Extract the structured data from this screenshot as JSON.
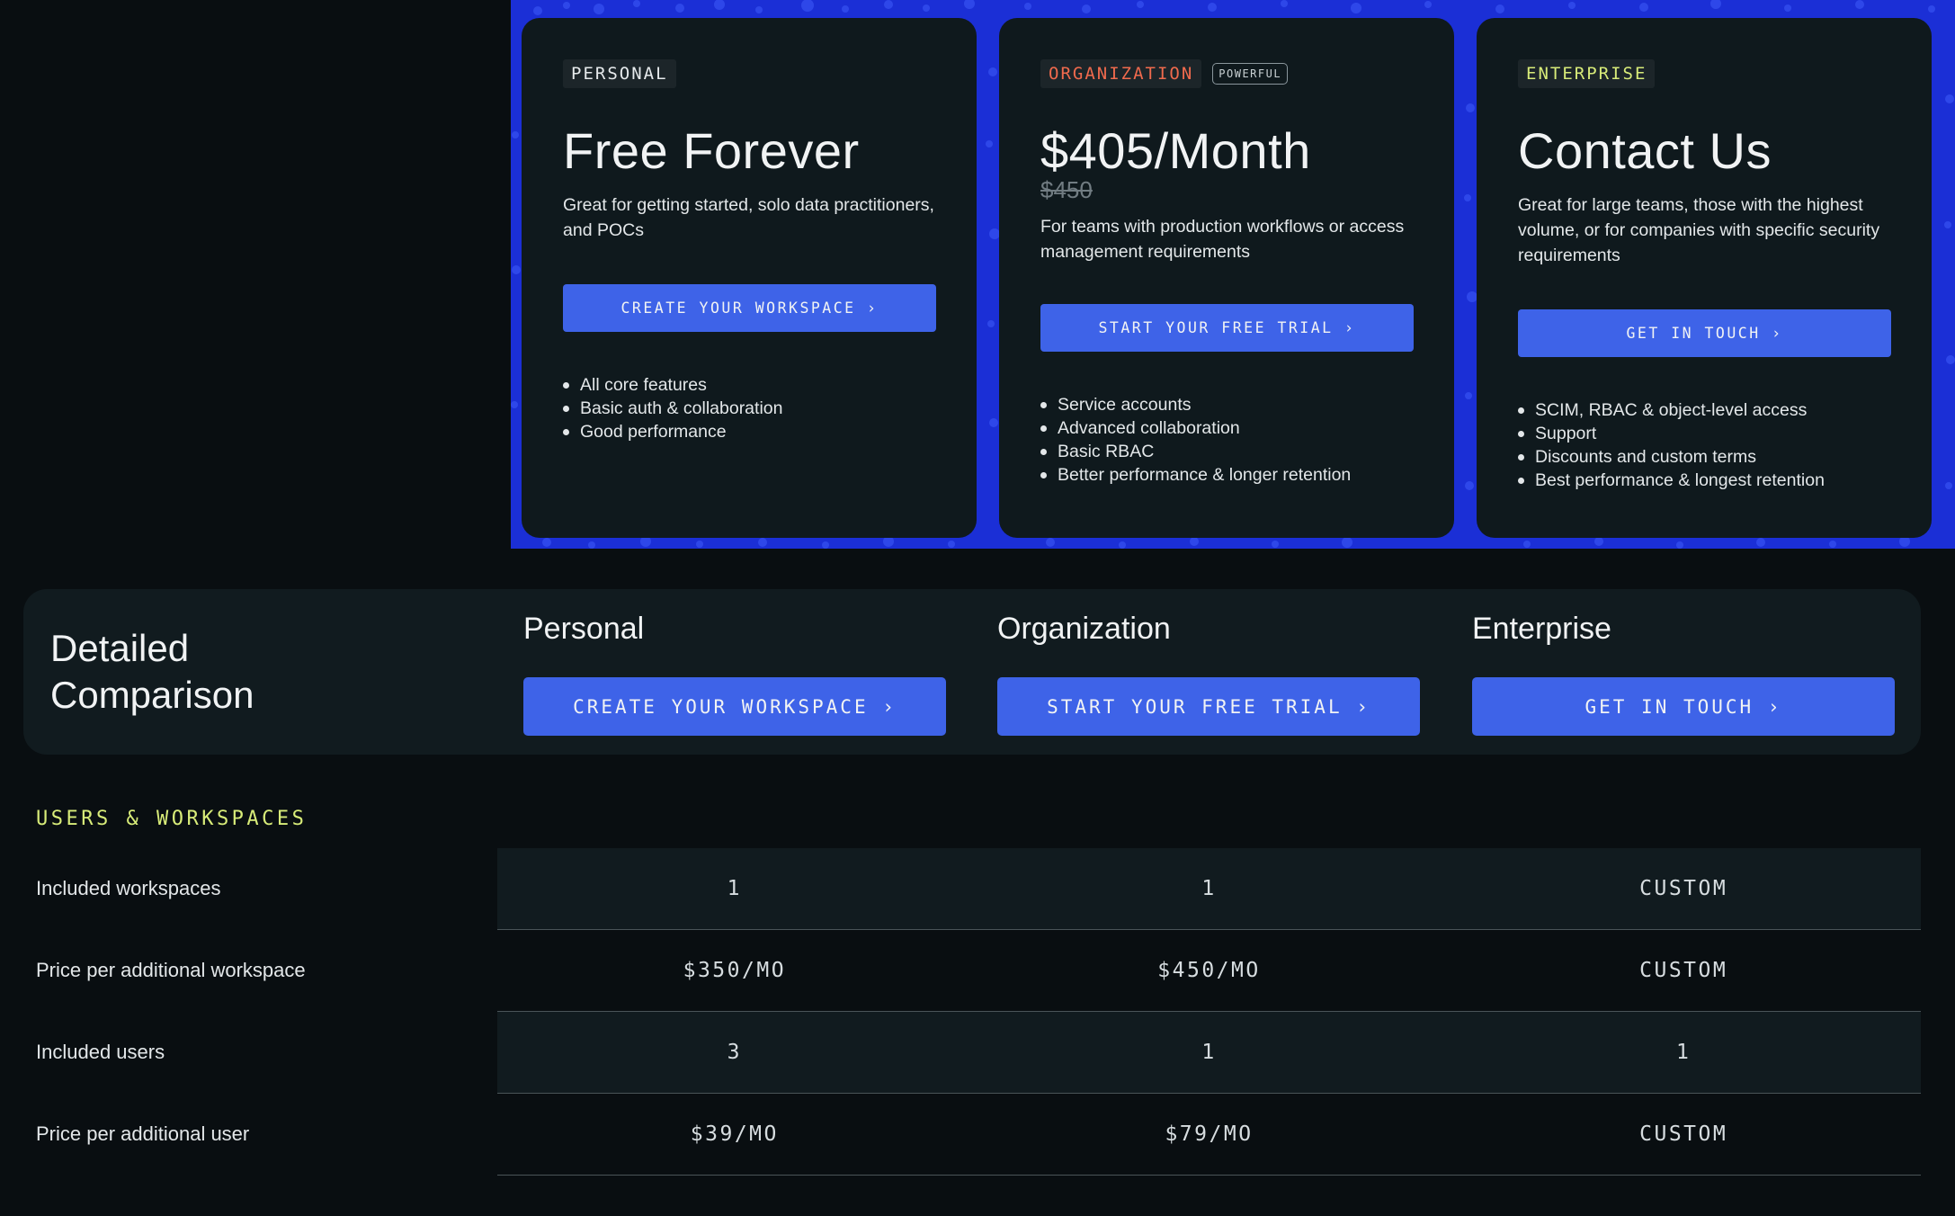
{
  "plans": [
    {
      "tag": "PERSONAL",
      "badge": "",
      "title": "Free Forever",
      "original_price": "",
      "description": "Great for getting started, solo data practitioners, and POCs",
      "cta": "CREATE YOUR WORKSPACE ›",
      "features": [
        "All core features",
        "Basic auth & collaboration",
        "Good performance"
      ]
    },
    {
      "tag": "ORGANIZATION",
      "badge": "POWERFUL",
      "title": "$405/Month",
      "original_price": "$450",
      "description": "For teams with production workflows or access management requirements",
      "cta": "START YOUR FREE TRIAL ›",
      "features": [
        "Service accounts",
        "Advanced collaboration",
        "Basic RBAC",
        "Better performance & longer retention"
      ]
    },
    {
      "tag": "ENTERPRISE",
      "badge": "",
      "title": "Contact Us",
      "original_price": "",
      "description": "Great for large teams, those with the highest volume, or for companies with specific security requirements",
      "cta": "GET IN TOUCH ›",
      "features": [
        "SCIM, RBAC & object-level access",
        "Support",
        "Discounts and custom terms",
        "Best performance & longest retention"
      ]
    }
  ],
  "comparison": {
    "title": "Detailed Comparison",
    "columns": [
      {
        "name": "Personal",
        "cta": "CREATE YOUR WORKSPACE ›"
      },
      {
        "name": "Organization",
        "cta": "START YOUR FREE TRIAL ›"
      },
      {
        "name": "Enterprise",
        "cta": "GET IN TOUCH ›"
      }
    ]
  },
  "table": {
    "section": "USERS & WORKSPACES",
    "rows": [
      {
        "label": "Included workspaces",
        "values": [
          "1",
          "1",
          "CUSTOM"
        ]
      },
      {
        "label": "Price per additional workspace",
        "values": [
          "$350/MO",
          "$450/MO",
          "CUSTOM"
        ]
      },
      {
        "label": "Included users",
        "values": [
          "3",
          "1",
          "1"
        ]
      },
      {
        "label": "Price per additional user",
        "values": [
          "$39/MO",
          "$79/MO",
          "CUSTOM"
        ]
      }
    ]
  },
  "colors": {
    "background": "#090e11",
    "banner": "#1b2fd6",
    "card": "#0f191d",
    "button": "#3e63e8",
    "organization_tag": "#f06a4d",
    "accent_lime": "#d8ec79"
  }
}
